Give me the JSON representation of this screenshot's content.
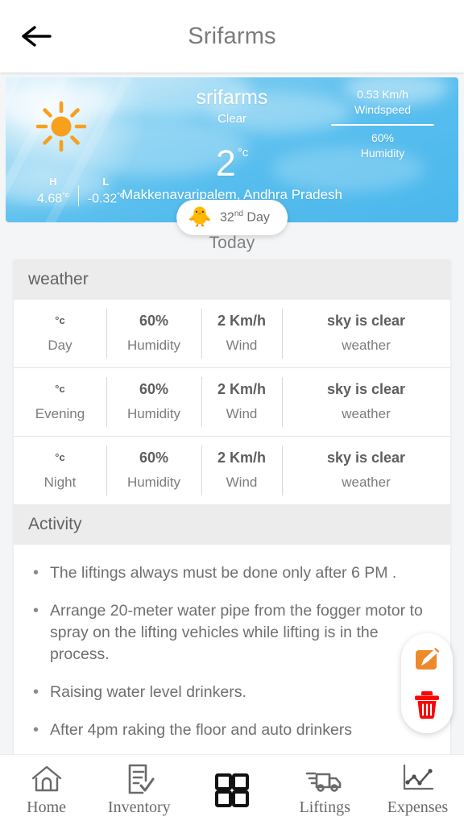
{
  "appbar": {
    "back_icon": "arrow-left-icon",
    "title": "Srifarms"
  },
  "weather": {
    "icon": "sun-icon",
    "farm_name": "srifarms",
    "condition": "Clear",
    "temperature": "2",
    "temperature_unit": "°c",
    "location": "Makkenavaripalem, Andhra Pradesh",
    "high_tag": "H",
    "high_value": "4.68",
    "high_unit": "°c",
    "low_tag": "L",
    "low_value": "-0.32",
    "low_unit": "°c",
    "windspeed_value": "0.53 Km/h",
    "windspeed_label": "Windspeed",
    "humidity_value": "60%",
    "humidity_label": "Humidity",
    "sky_color": "#56bdee",
    "sun_color": "#f7a01b"
  },
  "day_chip": {
    "emoji": "🐥",
    "number": "32",
    "ordinal": "nd",
    "suffix": " Day"
  },
  "today_label": "Today",
  "weather_section": {
    "title": "weather",
    "rows": [
      {
        "temp": "",
        "temp_unit": "°c",
        "period": "Day",
        "humidity": "60%",
        "humidity_label": "Humidity",
        "wind": "2 Km/h",
        "wind_label": "Wind",
        "desc": "sky is clear",
        "desc_label": "weather"
      },
      {
        "temp": "",
        "temp_unit": "°c",
        "period": "Evening",
        "humidity": "60%",
        "humidity_label": "Humidity",
        "wind": "2 Km/h",
        "wind_label": "Wind",
        "desc": "sky is clear",
        "desc_label": "weather"
      },
      {
        "temp": "",
        "temp_unit": "°c",
        "period": "Night",
        "humidity": "60%",
        "humidity_label": "Humidity",
        "wind": "2 Km/h",
        "wind_label": "Wind",
        "desc": "sky is clear",
        "desc_label": "weather"
      }
    ]
  },
  "activity_section": {
    "title": "Activity",
    "items": [
      "The liftings always must be done only after 6 PM .",
      "Arrange 20-meter water pipe from the fogger motor to spray on the lifting vehicles while lifting is in the process.",
      "Raising water level drinkers.",
      "After 4pm raking the floor and auto drinkers"
    ]
  },
  "fab": {
    "edit_icon": "edit-pencil-icon",
    "edit_color": "#ec8a2c",
    "delete_icon": "trash-icon",
    "delete_color": "#fb0606"
  },
  "bottom_nav": {
    "items": [
      {
        "label": "Home",
        "icon": "home-icon",
        "active": false
      },
      {
        "label": "Inventory",
        "icon": "clipboard-check-icon",
        "active": false
      },
      {
        "label": "",
        "icon": "grid-squares-icon",
        "active": true
      },
      {
        "label": "Liftings",
        "icon": "delivery-truck-icon",
        "active": false
      },
      {
        "label": "Expenses",
        "icon": "line-chart-icon",
        "active": false
      }
    ]
  }
}
